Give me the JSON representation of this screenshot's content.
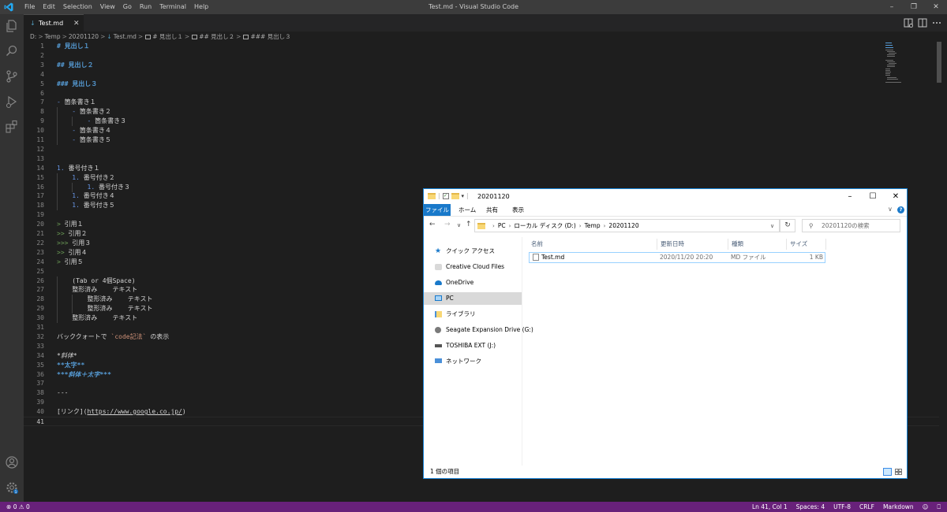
{
  "titlebar": {
    "menu": [
      "File",
      "Edit",
      "Selection",
      "View",
      "Go",
      "Run",
      "Terminal",
      "Help"
    ],
    "title": "Test.md - Visual Studio Code"
  },
  "tabs": [
    {
      "label": "Test.md",
      "icon": "markdown-icon",
      "active": true
    }
  ],
  "breadcrumb": {
    "path": [
      "D:",
      "Temp",
      "20201120"
    ],
    "file": "Test.md",
    "symbols": [
      "# 見出し１",
      "## 見出し２",
      "### 見出し３"
    ]
  },
  "editor": {
    "lines": [
      {
        "n": "1",
        "tokens": [
          {
            "t": "# 見出し１",
            "c": "h"
          }
        ]
      },
      {
        "n": "2",
        "tokens": []
      },
      {
        "n": "3",
        "tokens": [
          {
            "t": "## 見出し２",
            "c": "h"
          }
        ]
      },
      {
        "n": "4",
        "tokens": []
      },
      {
        "n": "5",
        "tokens": [
          {
            "t": "### 見出し３",
            "c": "h"
          }
        ]
      },
      {
        "n": "6",
        "tokens": []
      },
      {
        "n": "7",
        "tokens": [
          {
            "t": "- ",
            "c": "punc"
          },
          {
            "t": "箇条書き１",
            "c": "txt"
          }
        ]
      },
      {
        "n": "8",
        "tokens": [
          {
            "t": "    - ",
            "c": "punc"
          },
          {
            "t": "箇条書き２",
            "c": "txt"
          }
        ]
      },
      {
        "n": "9",
        "tokens": [
          {
            "t": "        - ",
            "c": "punc"
          },
          {
            "t": "箇条書き３",
            "c": "txt"
          }
        ]
      },
      {
        "n": "10",
        "tokens": [
          {
            "t": "    - ",
            "c": "punc"
          },
          {
            "t": "箇条書き４",
            "c": "txt"
          }
        ]
      },
      {
        "n": "11",
        "tokens": [
          {
            "t": "    - ",
            "c": "punc"
          },
          {
            "t": "箇条書き５",
            "c": "txt"
          }
        ]
      },
      {
        "n": "12",
        "tokens": []
      },
      {
        "n": "13",
        "tokens": []
      },
      {
        "n": "14",
        "tokens": [
          {
            "t": "1. ",
            "c": "punc"
          },
          {
            "t": "番号付き１",
            "c": "txt"
          }
        ]
      },
      {
        "n": "15",
        "tokens": [
          {
            "t": "    1. ",
            "c": "punc"
          },
          {
            "t": "番号付き２",
            "c": "txt"
          }
        ]
      },
      {
        "n": "16",
        "tokens": [
          {
            "t": "        1. ",
            "c": "punc"
          },
          {
            "t": "番号付き３",
            "c": "txt"
          }
        ]
      },
      {
        "n": "17",
        "tokens": [
          {
            "t": "    1. ",
            "c": "punc"
          },
          {
            "t": "番号付き４",
            "c": "txt"
          }
        ]
      },
      {
        "n": "18",
        "tokens": [
          {
            "t": "    1. ",
            "c": "punc"
          },
          {
            "t": "番号付き５",
            "c": "txt"
          }
        ]
      },
      {
        "n": "19",
        "tokens": []
      },
      {
        "n": "20",
        "tokens": [
          {
            "t": "> ",
            "c": "quote"
          },
          {
            "t": "引用１",
            "c": "txt"
          }
        ]
      },
      {
        "n": "21",
        "tokens": [
          {
            "t": ">> ",
            "c": "quote"
          },
          {
            "t": "引用２",
            "c": "txt"
          }
        ]
      },
      {
        "n": "22",
        "tokens": [
          {
            "t": ">>> ",
            "c": "quote"
          },
          {
            "t": "引用３",
            "c": "txt"
          }
        ]
      },
      {
        "n": "23",
        "tokens": [
          {
            "t": ">> ",
            "c": "quote"
          },
          {
            "t": "引用４",
            "c": "txt"
          }
        ]
      },
      {
        "n": "24",
        "tokens": [
          {
            "t": "> ",
            "c": "quote"
          },
          {
            "t": "引用５",
            "c": "txt"
          }
        ]
      },
      {
        "n": "25",
        "tokens": []
      },
      {
        "n": "26",
        "tokens": [
          {
            "t": "    (Tab or 4個Space)",
            "c": "txt"
          }
        ]
      },
      {
        "n": "27",
        "tokens": [
          {
            "t": "    整形済み    テキスト",
            "c": "txt"
          }
        ]
      },
      {
        "n": "28",
        "tokens": [
          {
            "t": "        整形済み    テキスト",
            "c": "txt"
          }
        ]
      },
      {
        "n": "29",
        "tokens": [
          {
            "t": "        整形済み    テキスト",
            "c": "txt"
          }
        ]
      },
      {
        "n": "30",
        "tokens": [
          {
            "t": "    整形済み    テキスト",
            "c": "txt"
          }
        ]
      },
      {
        "n": "31",
        "tokens": []
      },
      {
        "n": "32",
        "tokens": [
          {
            "t": "バッククォートで ",
            "c": "txt"
          },
          {
            "t": "`code記法`",
            "c": "code"
          },
          {
            "t": " の表示",
            "c": "txt"
          }
        ]
      },
      {
        "n": "33",
        "tokens": []
      },
      {
        "n": "34",
        "tokens": [
          {
            "t": "*斜体*",
            "c": "it"
          }
        ]
      },
      {
        "n": "35",
        "tokens": [
          {
            "t": "**太字**",
            "c": "b"
          }
        ]
      },
      {
        "n": "36",
        "tokens": [
          {
            "t": "***斜体＋太字***",
            "c": "bi"
          }
        ]
      },
      {
        "n": "37",
        "tokens": []
      },
      {
        "n": "38",
        "tokens": [
          {
            "t": "---",
            "c": "txt"
          }
        ]
      },
      {
        "n": "39",
        "tokens": []
      },
      {
        "n": "40",
        "tokens": [
          {
            "t": "[リンク](",
            "c": "link"
          },
          {
            "t": "https://www.google.co.jp/",
            "c": "url"
          },
          {
            "t": ")",
            "c": "link"
          }
        ]
      },
      {
        "n": "41",
        "tokens": []
      }
    ]
  },
  "statusbar": {
    "errors": "0",
    "warnings": "0",
    "items": [
      "Ln 41, Col 1",
      "Spaces: 4",
      "UTF-8",
      "CRLF",
      "Markdown"
    ]
  },
  "explorer": {
    "title": "20201120",
    "ribbon": {
      "file": "ファイル",
      "tabs": [
        "ホーム",
        "共有",
        "表示"
      ]
    },
    "address": [
      "PC",
      "ローカル ディスク (D:)",
      "Temp",
      "20201120"
    ],
    "search_placeholder": "20201120の検索",
    "nav": [
      {
        "label": "クイック アクセス",
        "icon": "star-icon"
      },
      {
        "label": "Creative Cloud Files",
        "icon": "creative-cloud-icon"
      },
      {
        "label": "OneDrive",
        "icon": "cloud-icon"
      },
      {
        "label": "PC",
        "icon": "computer-icon",
        "selected": true
      },
      {
        "label": "ライブラリ",
        "icon": "library-icon"
      },
      {
        "label": "Seagate Expansion Drive (G:)",
        "icon": "drive-icon"
      },
      {
        "label": "TOSHIBA EXT (J:)",
        "icon": "usb-drive-icon"
      },
      {
        "label": "ネットワーク",
        "icon": "network-icon"
      }
    ],
    "columns": [
      "名前",
      "更新日時",
      "種類",
      "サイズ"
    ],
    "files": [
      {
        "name": "Test.md",
        "modified": "2020/11/20 20:20",
        "type": "MD ファイル",
        "size": "1 KB"
      }
    ],
    "item_count": "1 個の項目"
  }
}
